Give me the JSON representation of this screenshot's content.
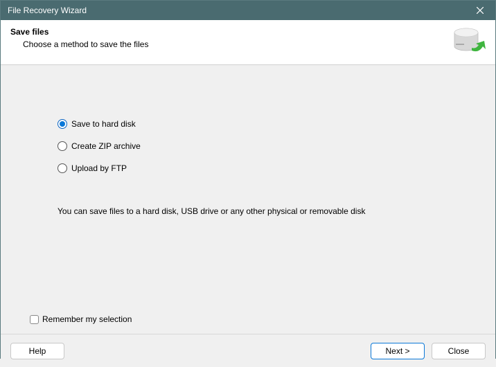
{
  "window": {
    "title": "File Recovery Wizard"
  },
  "header": {
    "title": "Save files",
    "subtitle": "Choose a method to save the files"
  },
  "options": [
    {
      "label": "Save to hard disk",
      "selected": true
    },
    {
      "label": "Create ZIP archive",
      "selected": false
    },
    {
      "label": "Upload by FTP",
      "selected": false
    }
  ],
  "description": "You can save files to a hard disk, USB drive or any other physical or removable disk",
  "remember": {
    "label": "Remember my selection",
    "checked": false
  },
  "buttons": {
    "help": "Help",
    "next": "Next >",
    "close": "Close"
  }
}
